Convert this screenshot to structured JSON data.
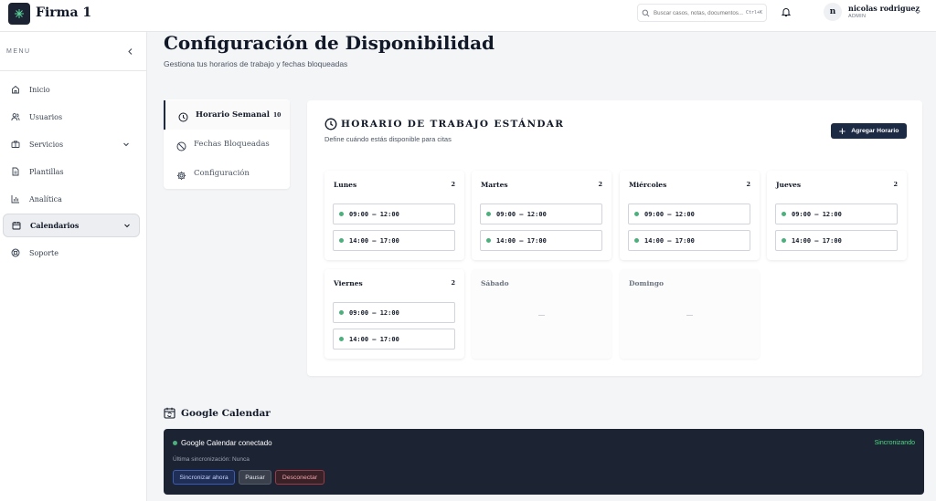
{
  "app": {
    "brand": "Firma 1",
    "search_placeholder": "Buscar casos, notas, documentos...",
    "search_shortcut": "Ctrl+K",
    "user": {
      "initial": "n",
      "name": "nicolas rodriguez",
      "role": "ADMIN"
    }
  },
  "sidebar": {
    "menu_label": "MENU",
    "items": [
      {
        "label": "Inicio",
        "icon": "home-icon"
      },
      {
        "label": "Usuarios",
        "icon": "users-icon"
      },
      {
        "label": "Servicios",
        "icon": "briefcase-icon",
        "has_chevron": true
      },
      {
        "label": "Plantillas",
        "icon": "file-icon"
      },
      {
        "label": "Analítica",
        "icon": "bar-chart-icon"
      },
      {
        "label": "Calendarios",
        "icon": "calendar-icon",
        "has_chevron": true,
        "active": true
      },
      {
        "label": "Soporte",
        "icon": "lifebuoy-icon"
      }
    ]
  },
  "page": {
    "title": "Configuración de Disponibilidad",
    "subtitle": "Gestiona tus horarios de trabajo y fechas bloqueadas"
  },
  "tabs": [
    {
      "label": "Horario Semanal",
      "count": "10",
      "active": true,
      "icon": "clock-icon"
    },
    {
      "label": "Fechas Bloqueadas",
      "icon": "ban-icon"
    },
    {
      "label": "Configuración",
      "icon": "settings-icon"
    }
  ],
  "schedule": {
    "title": "HORARIO DE TRABAJO ESTÁNDAR",
    "subtitle": "Define cuándo estás disponible para citas",
    "add_button": "Agregar Horario",
    "days": [
      {
        "name": "Lunes",
        "count": "2",
        "slots": [
          "09:00 – 12:00",
          "14:00 – 17:00"
        ]
      },
      {
        "name": "Martes",
        "count": "2",
        "slots": [
          "09:00 – 12:00",
          "14:00 – 17:00"
        ]
      },
      {
        "name": "Miércoles",
        "count": "2",
        "slots": [
          "09:00 – 12:00",
          "14:00 – 17:00"
        ]
      },
      {
        "name": "Jueves",
        "count": "2",
        "slots": [
          "09:00 – 12:00",
          "14:00 – 17:00"
        ]
      },
      {
        "name": "Viernes",
        "count": "2",
        "slots": [
          "09:00 – 12:00",
          "14:00 – 17:00"
        ]
      },
      {
        "name": "Sábado",
        "empty_text": "—"
      },
      {
        "name": "Domingo",
        "empty_text": "—"
      }
    ]
  },
  "google_calendar": {
    "title": "Google Calendar",
    "status": "Google Calendar conectado",
    "sync_state": "Sincronizando",
    "last_sync": "Última sincronización: Nunca",
    "buttons": {
      "sync": "Sincronizar ahora",
      "pause": "Pausar",
      "disconnect": "Desconectar"
    }
  },
  "colors": {
    "accent": "#1c2a44",
    "success": "#4caf7d",
    "dark_card": "#1c2333"
  }
}
